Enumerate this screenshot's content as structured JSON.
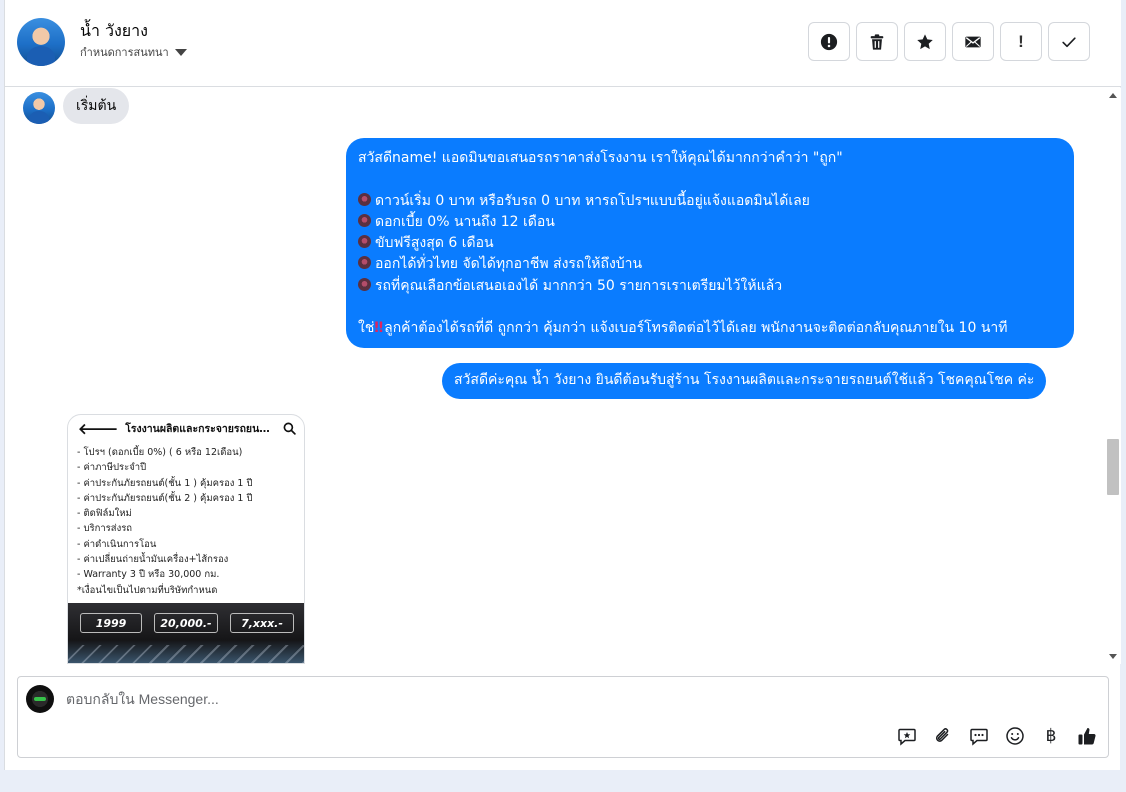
{
  "header": {
    "name": "น้ำ วังยาง",
    "subtitle": "กำหนดการสนทนา",
    "actions": [
      "mark-spam-icon",
      "trash-icon",
      "star-icon",
      "envelope-icon",
      "exclamation-icon",
      "check-icon"
    ],
    "action_glyph_exclamation": "!"
  },
  "thread": {
    "start_label": "เริ่มต้น",
    "outgoing_1": {
      "line1": "สวัสดีname! แอดมินขอเสนอรถราคาส่งโรงงาน เราให้คุณได้มากกว่าคำว่า \"ถูก\"",
      "bullets": [
        "ดาวน์เริ่ม 0 บาท หรือรับรถ 0 บาท หารถโปรฯแบบนี้อยู่แจ้งแอดมินได้เลย",
        "ดอกเบี้ย 0% นานถึง 12 เดือน",
        "ขับฟรีสูงสุด 6 เดือน",
        "ออกได้ทั่วไทย จัดได้ทุกอาชีพ ส่งรถให้ถึงบ้าน",
        "รถที่คุณเลือกข้อเสนอเองได้ มากกว่า 50 รายการเราเตรียมไว้ให้แล้ว"
      ],
      "closing_prefix": "ใช่",
      "closing_emoji": "‼",
      "closing_text": "ลูกค้าต้องได้รถที่ดี ถูกกว่า คุ้มกว่า แจ้งเบอร์โทรติดต่อไว้ได้เลย พนักงานจะติดต่อกลับคุณภายใน 10 นาที"
    },
    "outgoing_2": "สวัสดีค่ะคุณ น้ำ วังยาง ยินดีต้อนรับสู่ร้าน โรงงานผลิตและกระจายรถยนต์ใช้แล้ว โชคคุณโชค ค่ะ",
    "image_card": {
      "title": "โรงงานผลิตและกระจายรถยนต์ใ...",
      "list": [
        "- โปรฯ (ดอกเบี้ย 0%) ( 6 หรือ 12เดือน)",
        "- ค่าภาษีประจำปี",
        "- ค่าประกันภัยรถยนต์(ชั้น 1 ) คุ้มครอง 1 ปี",
        "- ค่าประกันภัยรถยนต์(ชั้น 2 ) คุ้มครอง 1 ปี",
        "- ติดฟิล์มใหม่",
        "- บริการส่งรถ",
        "- ค่าดำเนินการโอน",
        "- ค่าเปลี่ยนถ่ายน้ำมันเครื่อง+ไส้กรอง",
        "- Warranty 3 ปี หรือ 30,000 กม.",
        "*เงื่อนไขเป็นไปตามที่บริษัทกำหนด"
      ],
      "prices": [
        "1999",
        "20,000.-",
        "7,xxx.-"
      ]
    }
  },
  "composer": {
    "placeholder": "ตอบกลับใน Messenger...",
    "tools": [
      "saved-reply-icon",
      "attachment-icon",
      "chat-bubble-icon",
      "emoji-icon",
      "baht-icon",
      "thumbs-up-icon"
    ],
    "baht_glyph": "฿"
  },
  "colors": {
    "outgoing_bubble": "#0a7cff",
    "incoming_bubble": "#e4e6eb",
    "page_background": "#e9eef8"
  }
}
